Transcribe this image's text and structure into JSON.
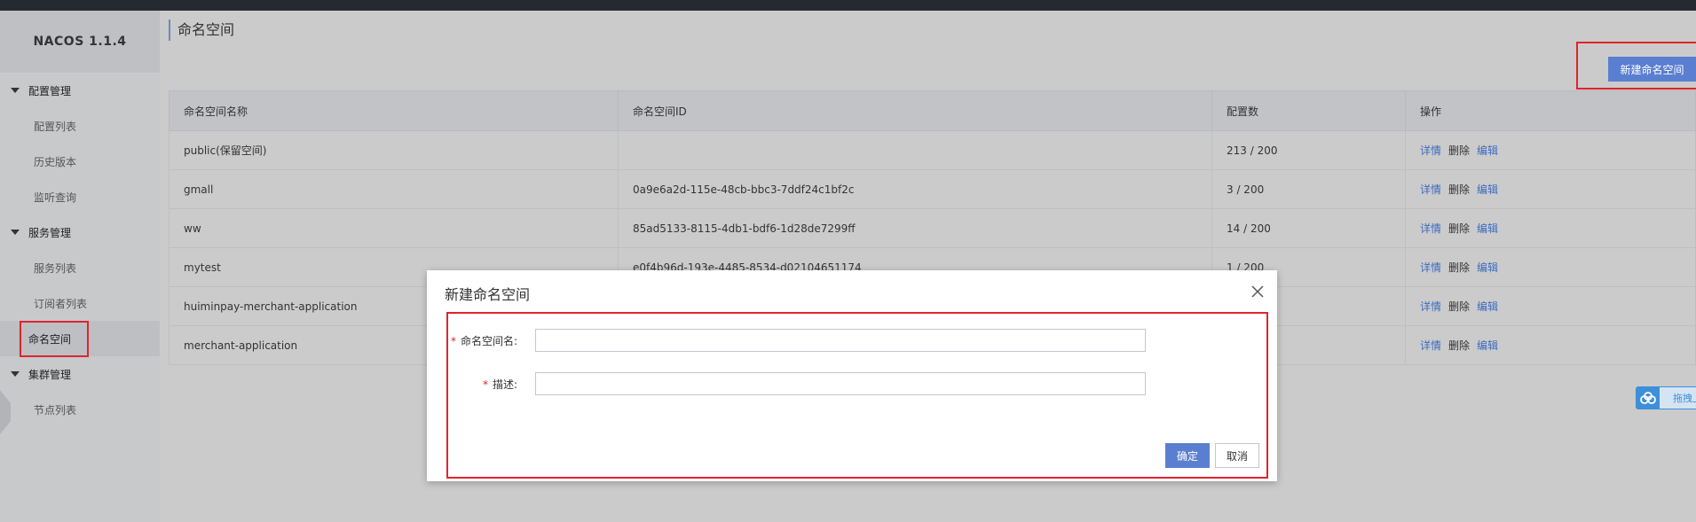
{
  "app": {
    "title": "NACOS 1.1.4"
  },
  "sidebar": {
    "groups": [
      {
        "label": "配置管理",
        "items": [
          {
            "label": "配置列表"
          },
          {
            "label": "历史版本"
          },
          {
            "label": "监听查询"
          }
        ]
      },
      {
        "label": "服务管理",
        "items": [
          {
            "label": "服务列表"
          },
          {
            "label": "订阅者列表"
          },
          {
            "label": "命名空间"
          }
        ]
      },
      {
        "label": "集群管理",
        "items": [
          {
            "label": "节点列表"
          }
        ]
      }
    ],
    "active_item": "命名空间"
  },
  "main": {
    "title": "命名空间",
    "new_button": "新建命名空间",
    "table": {
      "headers": [
        "命名空间名称",
        "命名空间ID",
        "配置数",
        "操作"
      ],
      "rows": [
        {
          "name": "public(保留空间)",
          "id": "",
          "count": "213 / 200"
        },
        {
          "name": "gmall",
          "id": "0a9e6a2d-115e-48cb-bbc3-7ddf24c1bf2c",
          "count": "3 / 200"
        },
        {
          "name": "ww",
          "id": "85ad5133-8115-4db1-bdf6-1d28de7299ff",
          "count": "14 / 200"
        },
        {
          "name": "mytest",
          "id": "e0f4b96d-193e-4485-8534-d02104651174",
          "count": "1 / 200"
        },
        {
          "name": "huiminpay-merchant-application",
          "id": "",
          "count": ""
        },
        {
          "name": "merchant-application",
          "id": "",
          "count": ""
        }
      ],
      "actions": {
        "detail": "详情",
        "delete": "删除",
        "edit": "编辑"
      }
    },
    "upload_label": "拖拽上传"
  },
  "dialog": {
    "title": "新建命名空间",
    "fields": [
      {
        "label": "命名空间名:",
        "value": "",
        "required": true
      },
      {
        "label": "描述:",
        "value": "",
        "required": true
      }
    ],
    "ok": "确定",
    "cancel": "取消"
  },
  "colors": {
    "primary": "#5b7fd0",
    "link": "#3b6bc2",
    "required": "#e0242d",
    "highlight": "#e0242d"
  },
  "icons": {
    "upload": "cloud-upload-icon",
    "close": "close-icon",
    "caret": "caret-down-icon"
  }
}
